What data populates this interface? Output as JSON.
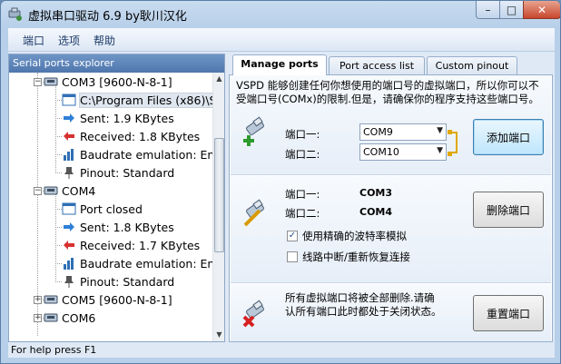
{
  "window": {
    "title": "虚拟串口驱动 6.9 by耿川汉化",
    "min_glyph": "–",
    "max_glyph": "□",
    "close_glyph": "✕"
  },
  "menu": {
    "items": [
      "端口",
      "选项",
      "帮助"
    ]
  },
  "explorer": {
    "header": "Serial ports explorer",
    "rows": [
      {
        "text": "COM3 [9600-N-8-1]",
        "icon": "serial-port-icon"
      },
      {
        "text": "C:\\Program Files (x86)\\S",
        "icon": "application-window-icon"
      },
      {
        "text": "Sent: 1.9 KBytes",
        "icon": "arrow-right-icon"
      },
      {
        "text": "Received: 1.8 KBytes",
        "icon": "arrow-left-icon"
      },
      {
        "text": "Baudrate emulation: Ena",
        "icon": "bar-chart-icon"
      },
      {
        "text": "Pinout: Standard",
        "icon": "pin-icon"
      },
      {
        "text": "COM4",
        "icon": "serial-port-icon"
      },
      {
        "text": "Port closed",
        "icon": "application-window-icon"
      },
      {
        "text": "Sent: 1.8 KBytes",
        "icon": "arrow-right-icon"
      },
      {
        "text": "Received: 1.7 KBytes",
        "icon": "arrow-left-icon"
      },
      {
        "text": "Baudrate emulation: Ena",
        "icon": "bar-chart-icon"
      },
      {
        "text": "Pinout: Standard",
        "icon": "pin-icon"
      },
      {
        "text": "COM5 [9600-N-8-1]",
        "icon": "serial-port-icon"
      },
      {
        "text": "COM6",
        "icon": "serial-port-icon"
      }
    ]
  },
  "tabs": [
    "Manage ports",
    "Port access list",
    "Custom pinout"
  ],
  "add_section": {
    "description": "VSPD 能够创建任何你想使用的端口号的虚拟端口，所以你可以不受端口号(COMx)的限制.但是，请确保你的程序支持这些端口号。",
    "port1_label": "端口一:",
    "port2_label": "端口二:",
    "port1_value": "COM9",
    "port2_value": "COM10",
    "button": "添加端口"
  },
  "delete_section": {
    "port1_label": "端口一:",
    "port2_label": "端口二:",
    "port1_value": "COM3",
    "port2_value": "COM4",
    "button": "删除端口",
    "check_baud": "使用精确的波特率模拟",
    "check_break": "线路中断/重新恢复连接"
  },
  "reset_section": {
    "description": "所有虚拟端口将被全部删除.请确认所有端口此时都处于关闭状态。",
    "button": "重置端口"
  },
  "status": "For help press F1",
  "colors": {
    "accent": "#3c7fb1",
    "header": "#4f77ad",
    "bracket": "#e0a800"
  }
}
